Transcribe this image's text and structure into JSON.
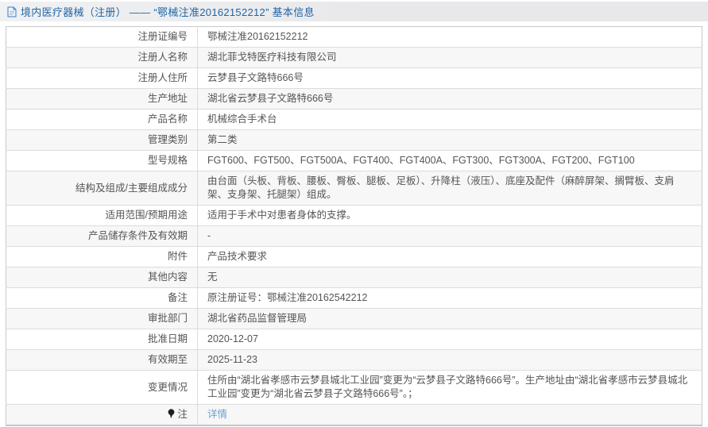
{
  "header": {
    "icon_name": "document-icon",
    "title": "境内医疗器械（注册） —— “鄂械注准20162152212” 基本信息"
  },
  "table": {
    "rows": [
      {
        "label": "注册证编号",
        "value": "鄂械注准20162152212"
      },
      {
        "label": "注册人名称",
        "value": "湖北菲戈特医疗科技有限公司"
      },
      {
        "label": "注册人住所",
        "value": "云梦县子文路特666号"
      },
      {
        "label": "生产地址",
        "value": "湖北省云梦县子文路特666号"
      },
      {
        "label": "产品名称",
        "value": "机械综合手术台"
      },
      {
        "label": "管理类别",
        "value": "第二类"
      },
      {
        "label": "型号规格",
        "value": "FGT600、FGT500、FGT500A、FGT400、FGT400A、FGT300、FGT300A、FGT200、FGT100"
      },
      {
        "label": "结构及组成/主要组成成分",
        "value": "由台面（头板、背板、腰板、臀板、腿板、足板）、升降柱（液压）、底座及配件（麻醉屏架、搁臂板、支肩架、支身架、托腿架）组成。"
      },
      {
        "label": "适用范围/预期用途",
        "value": "适用于手术中对患者身体的支撑。"
      },
      {
        "label": "产品储存条件及有效期",
        "value": "-"
      },
      {
        "label": "附件",
        "value": "产品技术要求"
      },
      {
        "label": "其他内容",
        "value": "无"
      },
      {
        "label": "备注",
        "value": "原注册证号：鄂械注准20162542212"
      },
      {
        "label": "审批部门",
        "value": "湖北省药品监督管理局"
      },
      {
        "label": "批准日期",
        "value": "2020-12-07"
      },
      {
        "label": "有效期至",
        "value": "2025-11-23"
      },
      {
        "label": "变更情况",
        "value": "住所由“湖北省孝感市云梦县城北工业园”变更为“云梦县子文路特666号”。生产地址由“湖北省孝感市云梦县城北工业园”变更为“湖北省云梦县子文路特666号”。；"
      },
      {
        "label": "注",
        "label_icon": "pin-icon",
        "value": "详情",
        "value_type": "link"
      }
    ]
  },
  "colors": {
    "title_blue": "#2166a5",
    "link_blue": "#6aa0d8",
    "row_alt_bg": "#f7f7f7",
    "table_border": "#c9c9c9",
    "row_border": "#dcdcdc",
    "header_bg": "#e8e8ea",
    "text": "#555555"
  }
}
